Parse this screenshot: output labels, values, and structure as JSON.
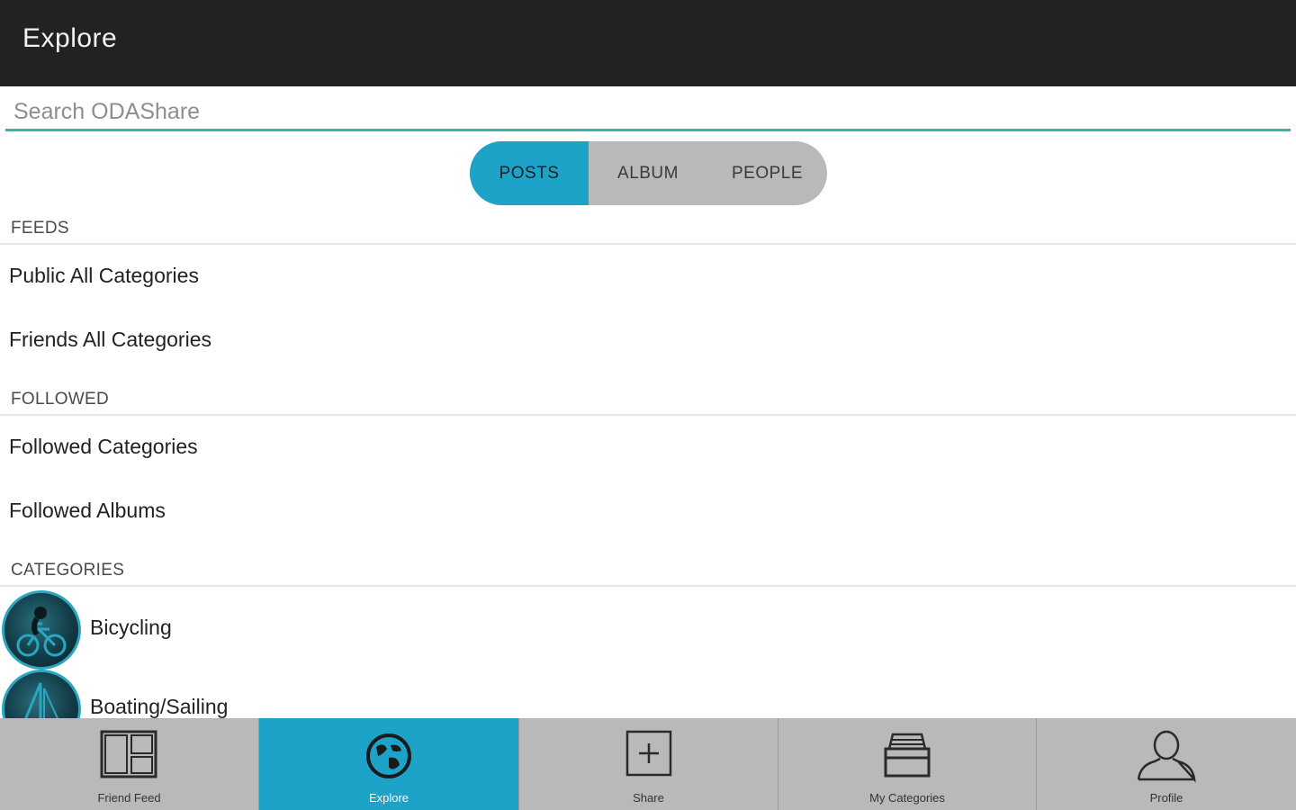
{
  "appbar": {
    "title": "Explore"
  },
  "search": {
    "placeholder": "Search ODAShare",
    "value": ""
  },
  "segmented": {
    "items": [
      {
        "label": "POSTS",
        "active": true
      },
      {
        "label": "ALBUM",
        "active": false
      },
      {
        "label": "PEOPLE",
        "active": false
      }
    ]
  },
  "sections": {
    "feeds": {
      "header": "FEEDS",
      "items": [
        {
          "label": "Public All Categories"
        },
        {
          "label": "Friends All Categories"
        }
      ]
    },
    "followed": {
      "header": "FOLLOWED",
      "items": [
        {
          "label": "Followed Categories"
        },
        {
          "label": "Followed Albums"
        }
      ]
    },
    "categories": {
      "header": "CATEGORIES",
      "items": [
        {
          "label": "Bicycling",
          "icon": "bicycle-icon"
        },
        {
          "label": "Boating/Sailing",
          "icon": "sailboat-icon"
        }
      ]
    }
  },
  "tabbar": {
    "items": [
      {
        "label": "Friend Feed",
        "icon": "friend-feed-icon",
        "active": false
      },
      {
        "label": "Explore",
        "icon": "globe-icon",
        "active": true
      },
      {
        "label": "Share",
        "icon": "add-box-icon",
        "active": false
      },
      {
        "label": "My Categories",
        "icon": "categories-box-icon",
        "active": false
      },
      {
        "label": "Profile",
        "icon": "person-icon",
        "active": false
      }
    ]
  },
  "colors": {
    "appbar_bg": "#222222",
    "accent_blue": "#1ea3c8",
    "search_underline": "#3cb4a6",
    "tabbar_bg": "#b9b9ba"
  }
}
